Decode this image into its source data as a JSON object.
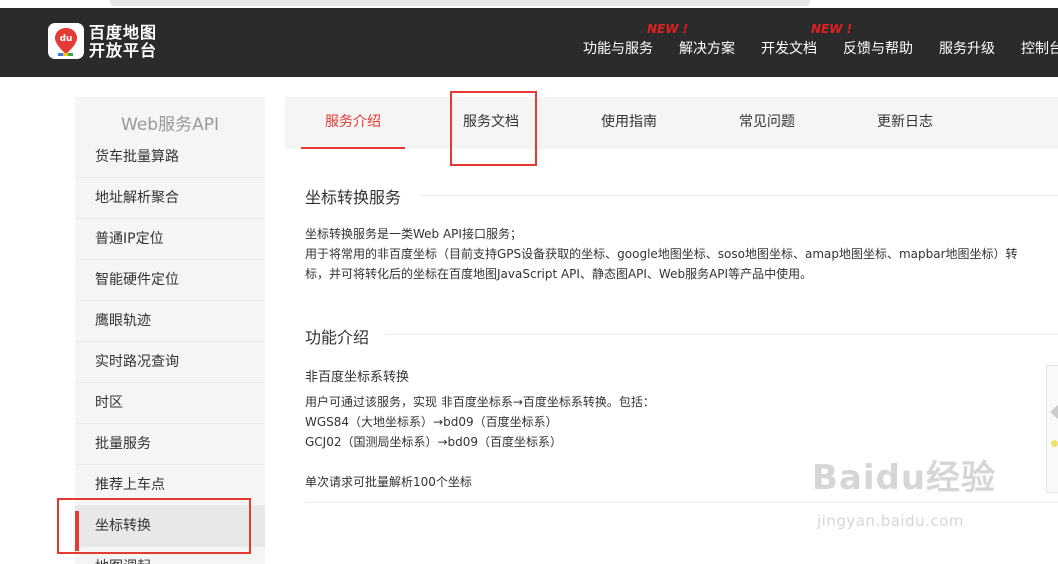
{
  "brand": {
    "logo_glyph": "du",
    "name_line1": "百度地图",
    "name_line2": "开放平台",
    "colors": {
      "header_bg": "#2b2b2b",
      "accent": "#e53935"
    }
  },
  "nav": {
    "items": [
      {
        "label": "功能与服务",
        "badge": "NEW !"
      },
      {
        "label": "解决方案",
        "badge": ""
      },
      {
        "label": "开发文档",
        "badge": "NEW !"
      },
      {
        "label": "反馈与帮助",
        "badge": ""
      },
      {
        "label": "服务升级",
        "badge": ""
      },
      {
        "label": "控制台",
        "badge": ""
      }
    ]
  },
  "sidebar": {
    "title": "Web服务API",
    "items": [
      {
        "label": "货车批量算路"
      },
      {
        "label": "地址解析聚合"
      },
      {
        "label": "普通IP定位"
      },
      {
        "label": "智能硬件定位"
      },
      {
        "label": "鹰眼轨迹"
      },
      {
        "label": "实时路况查询"
      },
      {
        "label": "时区"
      },
      {
        "label": "批量服务"
      },
      {
        "label": "推荐上车点"
      },
      {
        "label": "坐标转换",
        "active": true
      },
      {
        "label": "地图调起"
      }
    ]
  },
  "tabs": [
    {
      "label": "服务介绍",
      "active": true
    },
    {
      "label": "服务文档"
    },
    {
      "label": "使用指南"
    },
    {
      "label": "常见问题"
    },
    {
      "label": "更新日志"
    }
  ],
  "content": {
    "section1": {
      "title": "坐标转换服务",
      "line1": "坐标转换服务是一类Web API接口服务；",
      "line2": "用于将常用的非百度坐标（目前支持GPS设备获取的坐标、google地图坐标、soso地图坐标、amap地图坐标、mapbar地图坐标）转",
      "line3": "标，并可将转化后的坐标在百度地图JavaScript API、静态图API、Web服务API等产品中使用。"
    },
    "section2": {
      "title": "功能介绍",
      "subtitle": "非百度坐标系转换",
      "line1": "用户可通过该服务，实现 非百度坐标系→百度坐标系转换。包括：",
      "line2": "WGS84（大地坐标系）→bd09（百度坐标系）",
      "line3": "GCJ02（国测局坐标系）→bd09（百度坐标系）",
      "line4": "单次请求可批量解析100个坐标"
    }
  },
  "watermark": {
    "brand": "Baidu经验",
    "url": "jingyan.baidu.com"
  }
}
